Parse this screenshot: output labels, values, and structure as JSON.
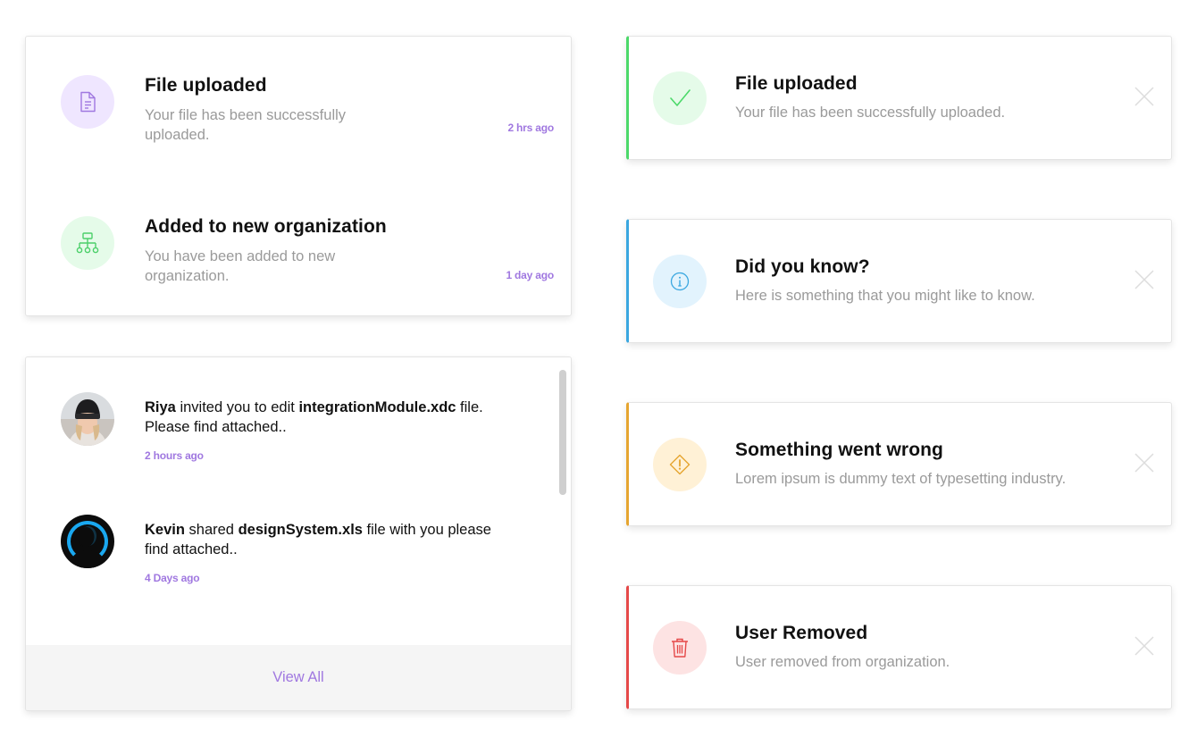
{
  "activity": {
    "items": [
      {
        "icon": "document-icon",
        "title": "File uploaded",
        "description": "Your file has been successfully uploaded.",
        "time": "2 hrs ago",
        "color": "#a078e0",
        "bg": "#efe6ff"
      },
      {
        "icon": "organization-icon",
        "title": "Added to new organization",
        "description": "You have been added to new organization.",
        "time": "1 day ago",
        "color": "#4cd06a",
        "bg": "#e5fbe9"
      }
    ]
  },
  "messages": {
    "items": [
      {
        "user": "Riya",
        "action": " invited you to edit ",
        "file": "integrationModule.xdc",
        "rest": " file. Please find attached..",
        "time": "2 hours ago"
      },
      {
        "user": "Kevin",
        "action": " shared ",
        "file": "designSystem.xls",
        "rest": " file with you please find attached..",
        "time": "4 Days ago"
      }
    ],
    "view_all": "View All"
  },
  "toasts": [
    {
      "type": "success",
      "icon": "check-icon",
      "title": "File uploaded",
      "message": "Your file has been successfully uploaded.",
      "accent": "#4cd96a",
      "bg": "#e5fbe9"
    },
    {
      "type": "info",
      "icon": "info-icon",
      "title": "Did you know?",
      "message": "Here is something that you might like to know.",
      "accent": "#3aa7e0",
      "bg": "#e2f3fd"
    },
    {
      "type": "warning",
      "icon": "warning-icon",
      "title": "Something went wrong",
      "message": "Lorem ipsum is dummy text of typesetting industry.",
      "accent": "#e6a530",
      "bg": "#fff1d6"
    },
    {
      "type": "error",
      "icon": "trash-icon",
      "title": "User Removed",
      "message": "User removed from organization.",
      "accent": "#e54848",
      "bg": "#fde3e3"
    }
  ]
}
